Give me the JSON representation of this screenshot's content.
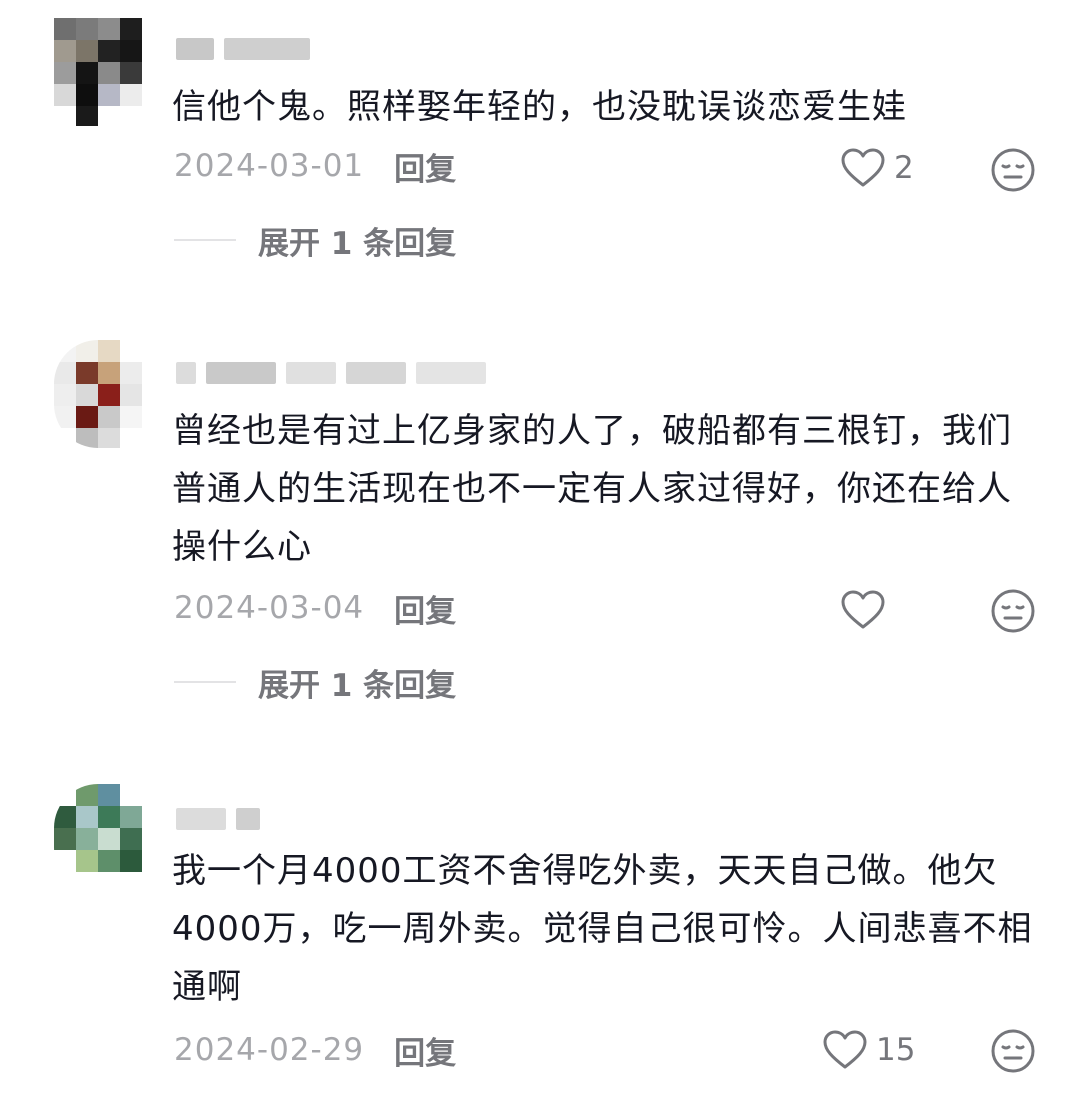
{
  "comments": [
    {
      "text": "信他个鬼。照样娶年轻的，也没耽误谈恋爱生娃",
      "date": "2024-03-01",
      "reply_label": "回复",
      "likes": "2",
      "expand_label": "展开 1 条回复"
    },
    {
      "text": "曾经也是有过上亿身家的人了，破船都有三根钉，我们普通人的生活现在也不一定有人家过得好，你还在给人操什么心",
      "date": "2024-03-04",
      "reply_label": "回复",
      "likes": "",
      "expand_label": "展开 1 条回复"
    },
    {
      "text": "我一个月4000工资不舍得吃外卖，天天自己做。他欠4000万，吃一周外卖。觉得自己很可怜。人间悲喜不相通啊",
      "date": "2024-02-29",
      "reply_label": "回复",
      "likes": "15"
    }
  ],
  "colors": {
    "text": "#161823",
    "date": "#a6a7ab",
    "secondary": "#75767b"
  },
  "icons": {
    "like": "heart-outline-icon",
    "dislike": "neutral-face-icon"
  }
}
